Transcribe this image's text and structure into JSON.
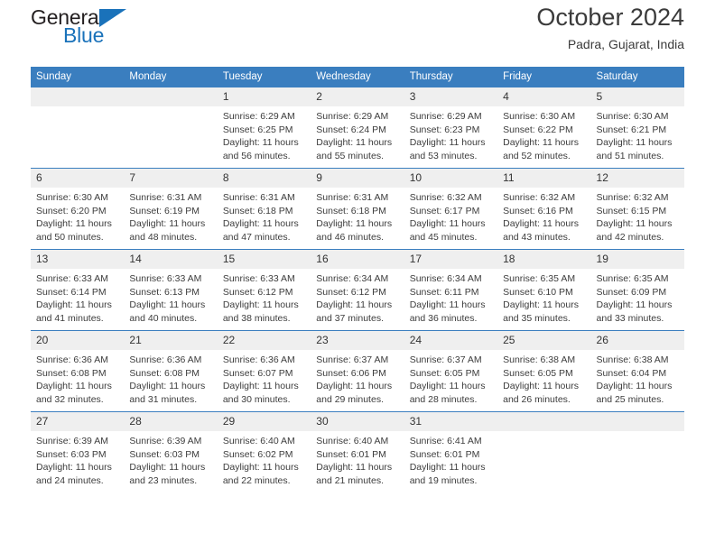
{
  "brand": {
    "word1": "General",
    "word2": "Blue",
    "mark": "triangle-logo"
  },
  "header": {
    "title": "October 2024",
    "subtitle": "Padra, Gujarat, India"
  },
  "colors": {
    "header_blue": "#3a7ebf",
    "brand_blue": "#1a72ba",
    "daynum_gray": "#efefef",
    "text": "#333333"
  },
  "calendar": {
    "weekdays": [
      "Sunday",
      "Monday",
      "Tuesday",
      "Wednesday",
      "Thursday",
      "Friday",
      "Saturday"
    ],
    "weeks": [
      [
        {
          "day": "",
          "sunrise": "",
          "sunset": "",
          "daylight1": "",
          "daylight2": ""
        },
        {
          "day": "",
          "sunrise": "",
          "sunset": "",
          "daylight1": "",
          "daylight2": ""
        },
        {
          "day": "1",
          "sunrise": "Sunrise: 6:29 AM",
          "sunset": "Sunset: 6:25 PM",
          "daylight1": "Daylight: 11 hours",
          "daylight2": "and 56 minutes."
        },
        {
          "day": "2",
          "sunrise": "Sunrise: 6:29 AM",
          "sunset": "Sunset: 6:24 PM",
          "daylight1": "Daylight: 11 hours",
          "daylight2": "and 55 minutes."
        },
        {
          "day": "3",
          "sunrise": "Sunrise: 6:29 AM",
          "sunset": "Sunset: 6:23 PM",
          "daylight1": "Daylight: 11 hours",
          "daylight2": "and 53 minutes."
        },
        {
          "day": "4",
          "sunrise": "Sunrise: 6:30 AM",
          "sunset": "Sunset: 6:22 PM",
          "daylight1": "Daylight: 11 hours",
          "daylight2": "and 52 minutes."
        },
        {
          "day": "5",
          "sunrise": "Sunrise: 6:30 AM",
          "sunset": "Sunset: 6:21 PM",
          "daylight1": "Daylight: 11 hours",
          "daylight2": "and 51 minutes."
        }
      ],
      [
        {
          "day": "6",
          "sunrise": "Sunrise: 6:30 AM",
          "sunset": "Sunset: 6:20 PM",
          "daylight1": "Daylight: 11 hours",
          "daylight2": "and 50 minutes."
        },
        {
          "day": "7",
          "sunrise": "Sunrise: 6:31 AM",
          "sunset": "Sunset: 6:19 PM",
          "daylight1": "Daylight: 11 hours",
          "daylight2": "and 48 minutes."
        },
        {
          "day": "8",
          "sunrise": "Sunrise: 6:31 AM",
          "sunset": "Sunset: 6:18 PM",
          "daylight1": "Daylight: 11 hours",
          "daylight2": "and 47 minutes."
        },
        {
          "day": "9",
          "sunrise": "Sunrise: 6:31 AM",
          "sunset": "Sunset: 6:18 PM",
          "daylight1": "Daylight: 11 hours",
          "daylight2": "and 46 minutes."
        },
        {
          "day": "10",
          "sunrise": "Sunrise: 6:32 AM",
          "sunset": "Sunset: 6:17 PM",
          "daylight1": "Daylight: 11 hours",
          "daylight2": "and 45 minutes."
        },
        {
          "day": "11",
          "sunrise": "Sunrise: 6:32 AM",
          "sunset": "Sunset: 6:16 PM",
          "daylight1": "Daylight: 11 hours",
          "daylight2": "and 43 minutes."
        },
        {
          "day": "12",
          "sunrise": "Sunrise: 6:32 AM",
          "sunset": "Sunset: 6:15 PM",
          "daylight1": "Daylight: 11 hours",
          "daylight2": "and 42 minutes."
        }
      ],
      [
        {
          "day": "13",
          "sunrise": "Sunrise: 6:33 AM",
          "sunset": "Sunset: 6:14 PM",
          "daylight1": "Daylight: 11 hours",
          "daylight2": "and 41 minutes."
        },
        {
          "day": "14",
          "sunrise": "Sunrise: 6:33 AM",
          "sunset": "Sunset: 6:13 PM",
          "daylight1": "Daylight: 11 hours",
          "daylight2": "and 40 minutes."
        },
        {
          "day": "15",
          "sunrise": "Sunrise: 6:33 AM",
          "sunset": "Sunset: 6:12 PM",
          "daylight1": "Daylight: 11 hours",
          "daylight2": "and 38 minutes."
        },
        {
          "day": "16",
          "sunrise": "Sunrise: 6:34 AM",
          "sunset": "Sunset: 6:12 PM",
          "daylight1": "Daylight: 11 hours",
          "daylight2": "and 37 minutes."
        },
        {
          "day": "17",
          "sunrise": "Sunrise: 6:34 AM",
          "sunset": "Sunset: 6:11 PM",
          "daylight1": "Daylight: 11 hours",
          "daylight2": "and 36 minutes."
        },
        {
          "day": "18",
          "sunrise": "Sunrise: 6:35 AM",
          "sunset": "Sunset: 6:10 PM",
          "daylight1": "Daylight: 11 hours",
          "daylight2": "and 35 minutes."
        },
        {
          "day": "19",
          "sunrise": "Sunrise: 6:35 AM",
          "sunset": "Sunset: 6:09 PM",
          "daylight1": "Daylight: 11 hours",
          "daylight2": "and 33 minutes."
        }
      ],
      [
        {
          "day": "20",
          "sunrise": "Sunrise: 6:36 AM",
          "sunset": "Sunset: 6:08 PM",
          "daylight1": "Daylight: 11 hours",
          "daylight2": "and 32 minutes."
        },
        {
          "day": "21",
          "sunrise": "Sunrise: 6:36 AM",
          "sunset": "Sunset: 6:08 PM",
          "daylight1": "Daylight: 11 hours",
          "daylight2": "and 31 minutes."
        },
        {
          "day": "22",
          "sunrise": "Sunrise: 6:36 AM",
          "sunset": "Sunset: 6:07 PM",
          "daylight1": "Daylight: 11 hours",
          "daylight2": "and 30 minutes."
        },
        {
          "day": "23",
          "sunrise": "Sunrise: 6:37 AM",
          "sunset": "Sunset: 6:06 PM",
          "daylight1": "Daylight: 11 hours",
          "daylight2": "and 29 minutes."
        },
        {
          "day": "24",
          "sunrise": "Sunrise: 6:37 AM",
          "sunset": "Sunset: 6:05 PM",
          "daylight1": "Daylight: 11 hours",
          "daylight2": "and 28 minutes."
        },
        {
          "day": "25",
          "sunrise": "Sunrise: 6:38 AM",
          "sunset": "Sunset: 6:05 PM",
          "daylight1": "Daylight: 11 hours",
          "daylight2": "and 26 minutes."
        },
        {
          "day": "26",
          "sunrise": "Sunrise: 6:38 AM",
          "sunset": "Sunset: 6:04 PM",
          "daylight1": "Daylight: 11 hours",
          "daylight2": "and 25 minutes."
        }
      ],
      [
        {
          "day": "27",
          "sunrise": "Sunrise: 6:39 AM",
          "sunset": "Sunset: 6:03 PM",
          "daylight1": "Daylight: 11 hours",
          "daylight2": "and 24 minutes."
        },
        {
          "day": "28",
          "sunrise": "Sunrise: 6:39 AM",
          "sunset": "Sunset: 6:03 PM",
          "daylight1": "Daylight: 11 hours",
          "daylight2": "and 23 minutes."
        },
        {
          "day": "29",
          "sunrise": "Sunrise: 6:40 AM",
          "sunset": "Sunset: 6:02 PM",
          "daylight1": "Daylight: 11 hours",
          "daylight2": "and 22 minutes."
        },
        {
          "day": "30",
          "sunrise": "Sunrise: 6:40 AM",
          "sunset": "Sunset: 6:01 PM",
          "daylight1": "Daylight: 11 hours",
          "daylight2": "and 21 minutes."
        },
        {
          "day": "31",
          "sunrise": "Sunrise: 6:41 AM",
          "sunset": "Sunset: 6:01 PM",
          "daylight1": "Daylight: 11 hours",
          "daylight2": "and 19 minutes."
        },
        {
          "day": "",
          "sunrise": "",
          "sunset": "",
          "daylight1": "",
          "daylight2": ""
        },
        {
          "day": "",
          "sunrise": "",
          "sunset": "",
          "daylight1": "",
          "daylight2": ""
        }
      ]
    ]
  }
}
